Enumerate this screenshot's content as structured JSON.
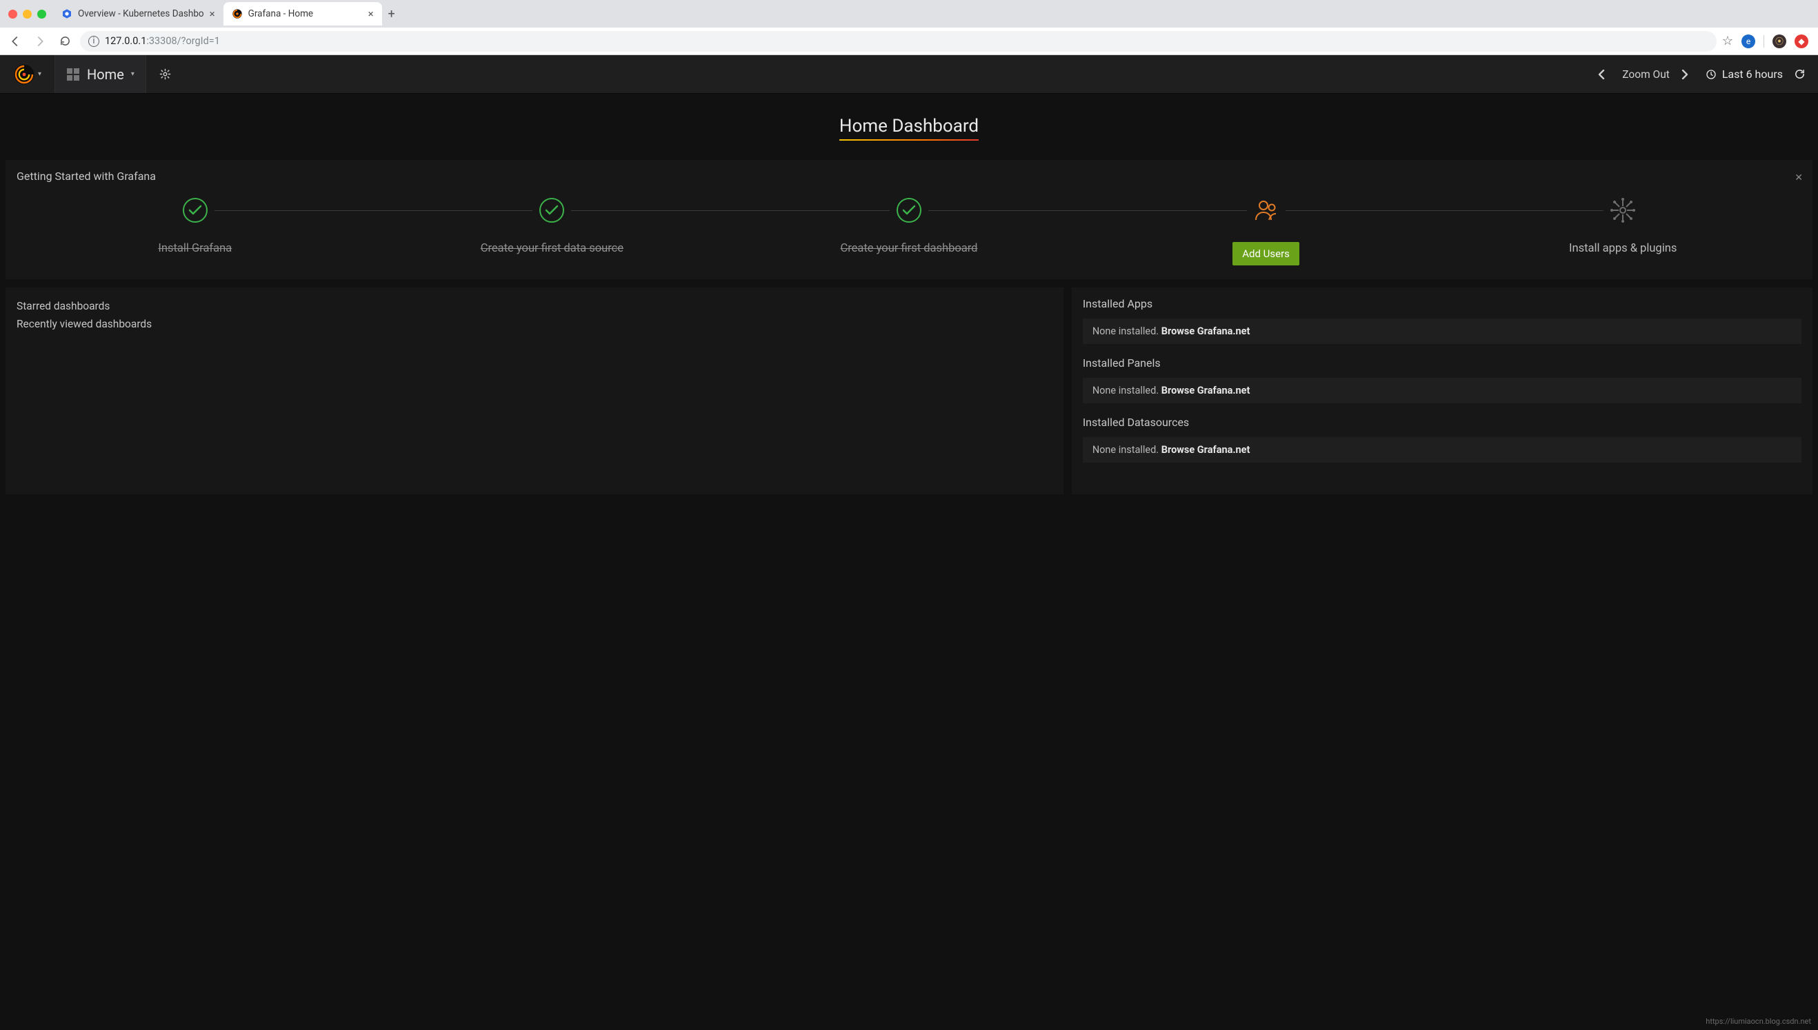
{
  "browser": {
    "tabs": [
      {
        "title": "Overview - Kubernetes Dashbo"
      },
      {
        "title": "Grafana - Home"
      }
    ],
    "url_host": "127.0.0.1",
    "url_rest": ":33308/?orgId=1"
  },
  "nav": {
    "breadcrumb": "Home",
    "zoom_out": "Zoom Out",
    "time_range": "Last 6 hours"
  },
  "dashboard_title": "Home Dashboard",
  "getting_started": {
    "title": "Getting Started with Grafana",
    "steps": [
      {
        "label": "Install Grafana",
        "state": "done",
        "icon": "check"
      },
      {
        "label": "Create your first data source",
        "state": "done",
        "icon": "check"
      },
      {
        "label": "Create your first dashboard",
        "state": "done",
        "icon": "check"
      },
      {
        "label": "Add Users",
        "state": "current",
        "icon": "users"
      },
      {
        "label": "Install apps & plugins",
        "state": "todo",
        "icon": "plugins"
      }
    ]
  },
  "left_panel": {
    "starred": "Starred dashboards",
    "recent": "Recently viewed dashboards"
  },
  "right_panel": {
    "apps_h": "Installed Apps",
    "panels_h": "Installed Panels",
    "ds_h": "Installed Datasources",
    "none_prefix": "None installed. ",
    "browse": "Browse Grafana.net"
  },
  "watermark": "https://liumiaocn.blog.csdn.net",
  "colors": {
    "green": "#3bb24a",
    "orange": "#e07b27",
    "grey": "#6d6d6d",
    "cta": "#6aa21a"
  }
}
